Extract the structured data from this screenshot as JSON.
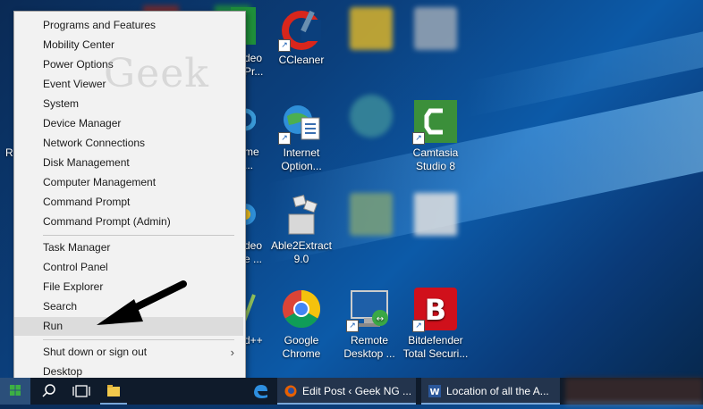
{
  "menu": {
    "items_top": [
      "Programs and Features",
      "Mobility Center",
      "Power Options",
      "Event Viewer",
      "System",
      "Device Manager",
      "Network Connections",
      "Disk Management",
      "Computer Management",
      "Command Prompt",
      "Command Prompt (Admin)"
    ],
    "items_mid": [
      "Task Manager",
      "Control Panel",
      "File Explorer",
      "Search",
      "Run"
    ],
    "items_bottom": [
      "Shut down or sign out",
      "Desktop"
    ],
    "submenu_chevron": "›",
    "highlighted": "Run"
  },
  "watermark": "Geek",
  "desktop": {
    "icons": [
      {
        "label_1": "CCleaner",
        "label_2": ""
      },
      {
        "label_1": "Internet",
        "label_2": "Option..."
      },
      {
        "label_1": "Camtasia",
        "label_2": "Studio 8"
      },
      {
        "label_1": "Able2Extract",
        "label_2": "9.0"
      },
      {
        "label_1": "Google",
        "label_2": "Chrome"
      },
      {
        "label_1": "Remote",
        "label_2": "Desktop ..."
      },
      {
        "label_1": "Bitdefender",
        "label_2": "Total Securi..."
      }
    ],
    "partial_labels": [
      {
        "line1": "deo",
        "line2": "Pr..."
      },
      {
        "line1": "me",
        "line2": "..."
      },
      {
        "line1": "deo",
        "line2": "e ..."
      },
      {
        "line1": "d++",
        "line2": ""
      },
      {
        "line1": "R",
        "line2": ""
      }
    ]
  },
  "taskbar": {
    "apps": [
      {
        "title": "Edit Post ‹ Geek NG ..."
      },
      {
        "title": "Location of all the A..."
      }
    ]
  },
  "colors": {
    "accent": "#7aa7d8",
    "ccleaner_red": "#d8261c",
    "camtasia_green": "#3b8f3a",
    "bitdefender_red": "#d0101b",
    "chrome_red": "#db4437",
    "chrome_yellow": "#f4c20d",
    "chrome_green": "#0f9d58",
    "chrome_blue": "#4285f4"
  }
}
